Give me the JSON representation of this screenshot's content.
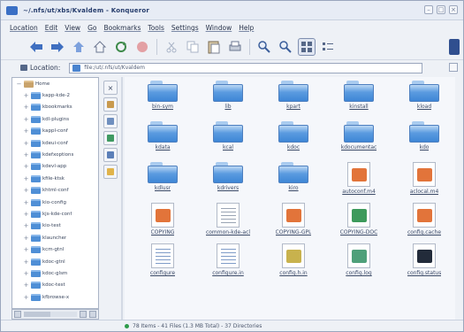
{
  "window": {
    "title": "~/.nfs/ut/xbs/Kvaldem - Konqueror"
  },
  "menu": [
    "Location",
    "Edit",
    "View",
    "Go",
    "Bookmarks",
    "Tools",
    "Settings",
    "Window",
    "Help"
  ],
  "location": {
    "label": "Location:",
    "value": "file:/ut/.nfs/ut/Kvaldem"
  },
  "tree": [
    {
      "label": "Home",
      "root": true
    },
    {
      "label": "kapp-kde-2"
    },
    {
      "label": "kbookmarks"
    },
    {
      "label": "kdl-plugins"
    },
    {
      "label": "kappl-conf"
    },
    {
      "label": "kdeui-conf"
    },
    {
      "label": "kdefxoptions"
    },
    {
      "label": "kdevl-app"
    },
    {
      "label": "kfile-ktsk"
    },
    {
      "label": "khtml-conf"
    },
    {
      "label": "kio-config"
    },
    {
      "label": "kjs-kde-conf"
    },
    {
      "label": "kio-test"
    },
    {
      "label": "klauncher"
    },
    {
      "label": "kcm-gtnl"
    },
    {
      "label": "kdoc-gtnl"
    },
    {
      "label": "kdoc-glsm"
    },
    {
      "label": "kdoc-test"
    },
    {
      "label": "kfbrowse-x"
    }
  ],
  "files": [
    {
      "name": "bin-sym",
      "kind": "folder"
    },
    {
      "name": "lib",
      "kind": "folder"
    },
    {
      "name": "kpart",
      "kind": "folder"
    },
    {
      "name": "kinstall",
      "kind": "folder"
    },
    {
      "name": "kload",
      "kind": "folder"
    },
    {
      "name": "kdata",
      "kind": "folder"
    },
    {
      "name": "kcal",
      "kind": "folder"
    },
    {
      "name": "kdoc",
      "kind": "folder"
    },
    {
      "name": "kdocumentac",
      "kind": "folder"
    },
    {
      "name": "kdo",
      "kind": "folder"
    },
    {
      "name": "kdlusr",
      "kind": "folder"
    },
    {
      "name": "kdrivers",
      "kind": "folder"
    },
    {
      "name": "kiro",
      "kind": "folder"
    },
    {
      "name": "autoconf.m4",
      "kind": "doc",
      "color": "#e2743a"
    },
    {
      "name": "aclocal.m4",
      "kind": "doc",
      "color": "#e2743a"
    },
    {
      "name": "COPYING",
      "kind": "doc",
      "color": "#e2743a"
    },
    {
      "name": "common-kde-acl",
      "kind": "doc-text",
      "color": "#9aa4b4"
    },
    {
      "name": "COPYING-GPL",
      "kind": "doc",
      "color": "#e2743a"
    },
    {
      "name": "COPYING-DOC",
      "kind": "doc",
      "color": "#3d9a5b"
    },
    {
      "name": "config.cache",
      "kind": "doc",
      "color": "#e2743a"
    },
    {
      "name": "configure",
      "kind": "doc-text",
      "color": "#7f9cc8"
    },
    {
      "name": "configure.in",
      "kind": "doc-text",
      "color": "#7f9cc8"
    },
    {
      "name": "config.h.in",
      "kind": "doc",
      "color": "#c8b24d"
    },
    {
      "name": "config.log",
      "kind": "doc",
      "color": "#4fa07a"
    },
    {
      "name": "config.status",
      "kind": "doc",
      "color": "#222b3a"
    }
  ],
  "status": {
    "text": "78 Items - 41 Files (1.3 MB Total) - 37 Directories"
  },
  "colors": {
    "accent": "#3e86d6",
    "window_bg": "#eef1f6"
  }
}
